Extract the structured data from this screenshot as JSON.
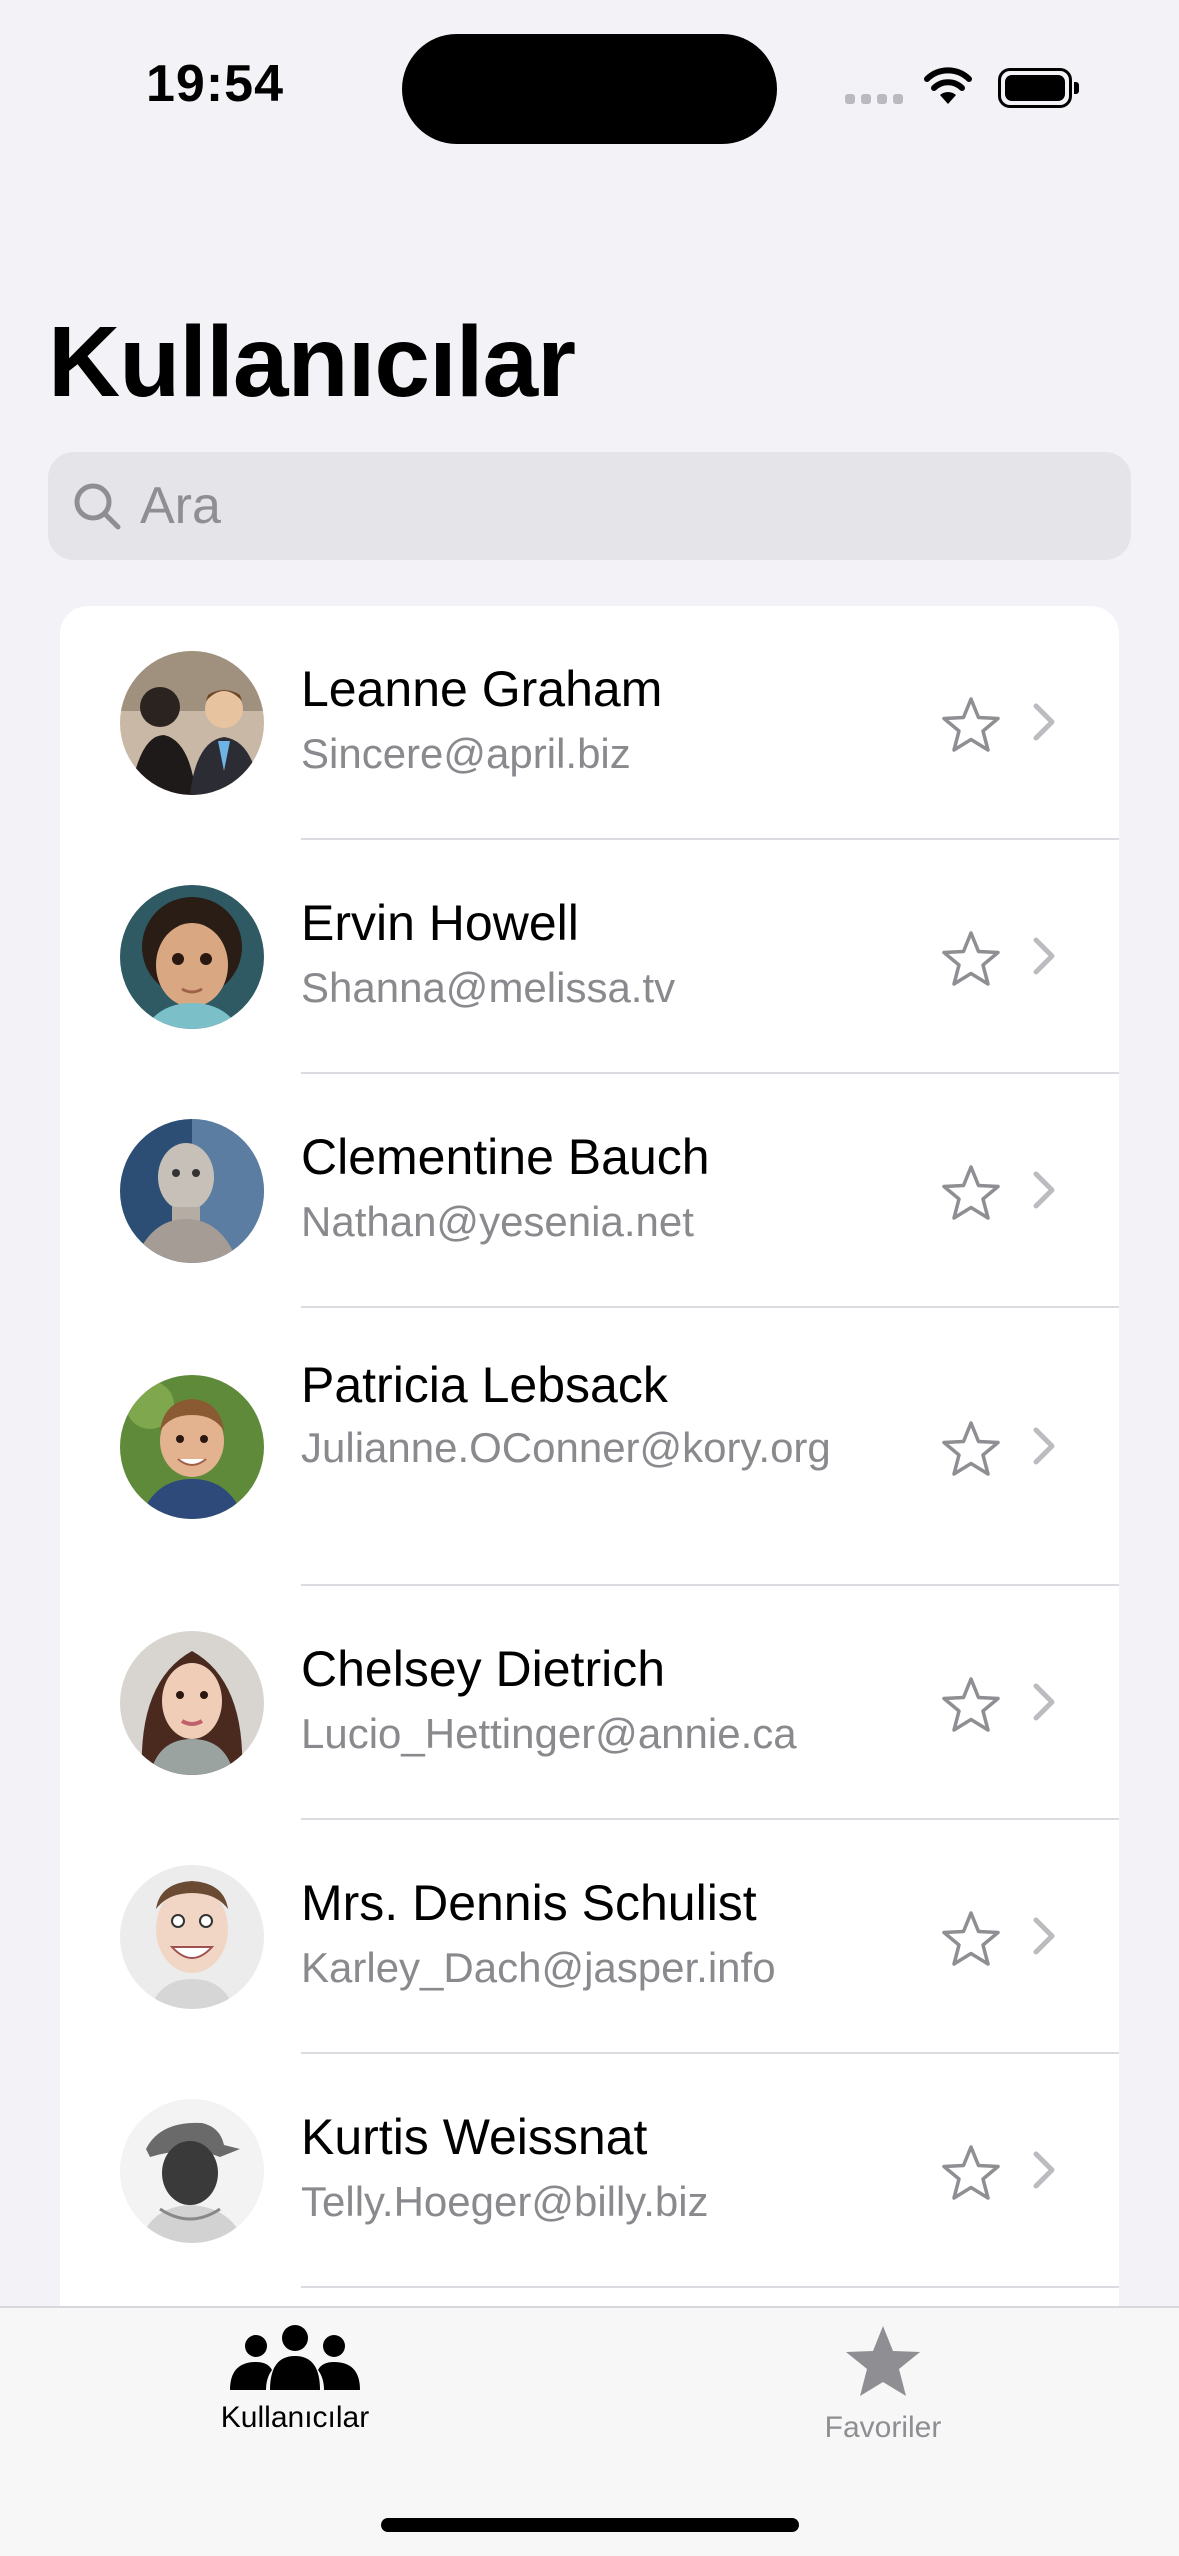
{
  "status_bar": {
    "time": "19:54"
  },
  "header": {
    "title": "Kullanıcılar"
  },
  "search": {
    "placeholder": "Ara",
    "value": ""
  },
  "users": [
    {
      "name": "Leanne Graham",
      "email": "Sincere@april.biz"
    },
    {
      "name": "Ervin Howell",
      "email": "Shanna@melissa.tv"
    },
    {
      "name": "Clementine Bauch",
      "email": "Nathan@yesenia.net"
    },
    {
      "name": "Patricia Lebsack",
      "email": "Julianne.OConner@kory.org"
    },
    {
      "name": "Chelsey Dietrich",
      "email": "Lucio_Hettinger@annie.ca"
    },
    {
      "name": "Mrs. Dennis Schulist",
      "email": "Karley_Dach@jasper.info"
    },
    {
      "name": "Kurtis Weissnat",
      "email": "Telly.Hoeger@billy.biz"
    }
  ],
  "tabbar": {
    "tabs": [
      {
        "label": "Kullanıcılar",
        "icon": "people-icon",
        "selected": true
      },
      {
        "label": "Favoriler",
        "icon": "star-fill-icon",
        "selected": false
      }
    ]
  },
  "colors": {
    "accent": "#000000",
    "secondary_text": "#8a8a8e",
    "inactive_tab": "#8e8e93",
    "background": "#f2f2f7"
  }
}
